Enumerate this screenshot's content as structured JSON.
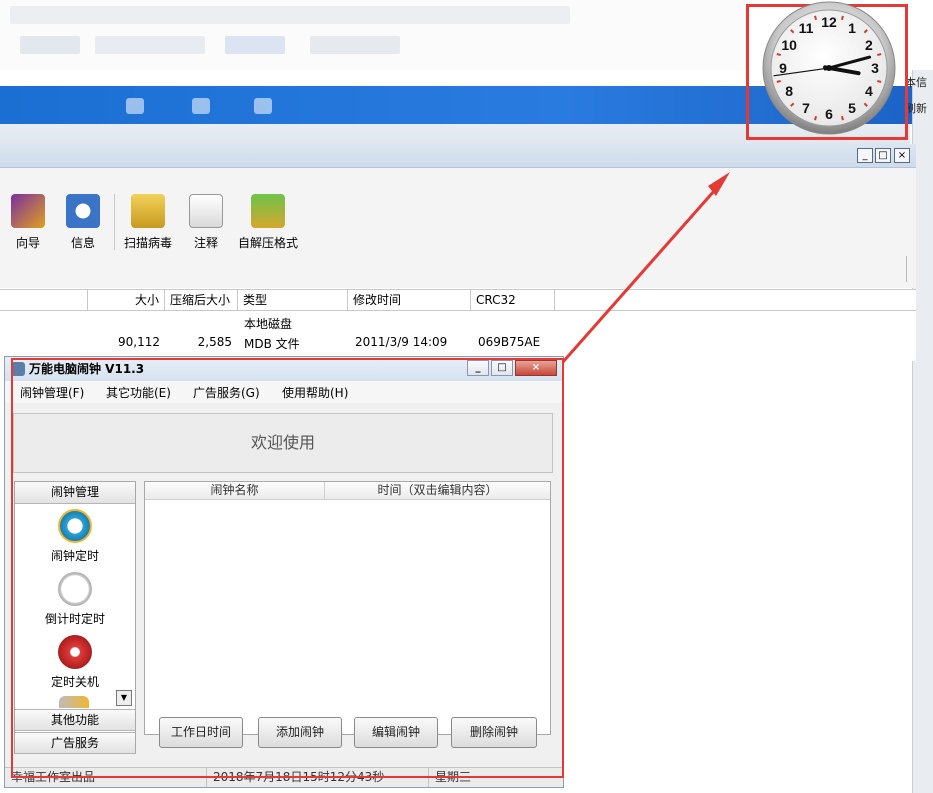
{
  "background_window": {
    "right_edge_texts": [
      "本信",
      "刷新"
    ],
    "toolbar": [
      {
        "label": "向导",
        "icon": "wizard-icon"
      },
      {
        "label": "信息",
        "icon": "info-icon"
      },
      {
        "label": "扫描病毒",
        "icon": "scan-virus-icon"
      },
      {
        "label": "注释",
        "icon": "comment-icon"
      },
      {
        "label": "自解压格式",
        "icon": "sfx-archive-icon"
      }
    ],
    "columns": [
      "大小",
      "压缩后大小",
      "类型",
      "修改时间",
      "CRC32"
    ],
    "rows": [
      {
        "size": "",
        "packed": "",
        "type": "本地磁盘",
        "modified": "",
        "crc": ""
      },
      {
        "size": "90,112",
        "packed": "2,585",
        "type": "MDB 文件",
        "modified": "2011/3/9 14:09",
        "crc": "069B75AE"
      }
    ],
    "window_buttons": [
      "_",
      "□",
      "×"
    ]
  },
  "clock": {
    "numbers": [
      "12",
      "1",
      "2",
      "3",
      "4",
      "5",
      "6",
      "7",
      "8",
      "9",
      "10",
      "11"
    ],
    "hour_angle_deg": 100,
    "minute_angle_deg": 75,
    "second_angle_deg": 262
  },
  "app": {
    "title": "万能电脑闹钟 V11.3",
    "menus": [
      "闹钟管理(F)",
      "其它功能(E)",
      "广告服务(G)",
      "使用帮助(H)"
    ],
    "welcome": "欢迎使用",
    "sidebar": {
      "header": "闹钟管理",
      "items": [
        {
          "label": "闹钟定时",
          "icon": "alarm-clock-icon"
        },
        {
          "label": "倒计时定时",
          "icon": "countdown-clock-icon"
        },
        {
          "label": "定时关机",
          "icon": "power-off-icon"
        }
      ],
      "footer_sections": [
        "其他功能",
        "广告服务"
      ]
    },
    "grid_columns": [
      "闹钟名称",
      "时间（双击编辑内容）"
    ],
    "buttons": [
      "工作日时间",
      "添加闹钟",
      "编辑闹钟",
      "删除闹钟"
    ],
    "status": [
      "幸福工作室出品",
      "2018年7月18日15时12分43秒",
      "星期三"
    ]
  }
}
